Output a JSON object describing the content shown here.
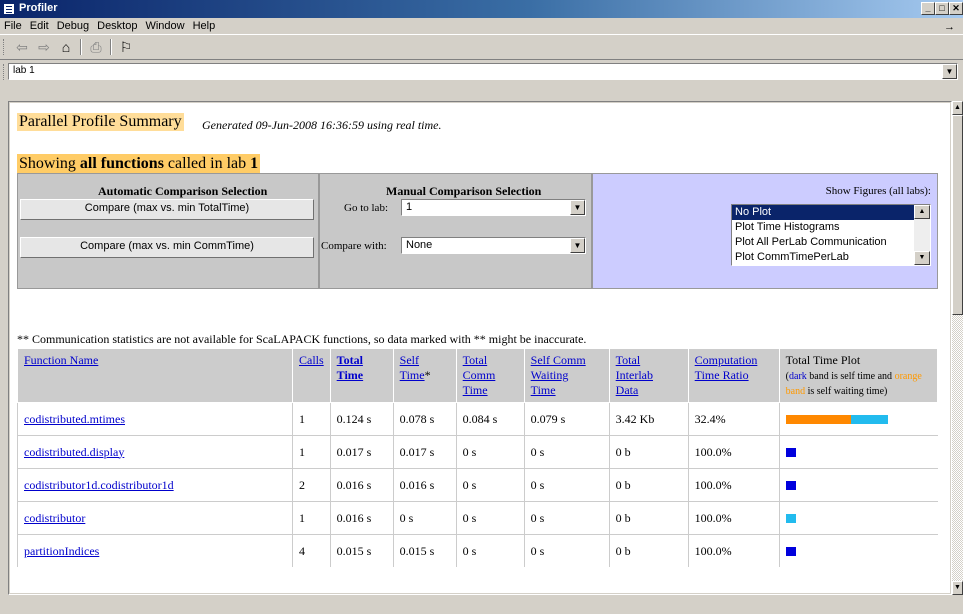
{
  "window": {
    "title": "Profiler"
  },
  "menu": [
    "File",
    "Edit",
    "Debug",
    "Desktop",
    "Window",
    "Help"
  ],
  "menu_arrow": "→",
  "toolbar": {
    "back_icon": "⇦",
    "forward_icon": "⇨",
    "home_icon": "⌂",
    "print_icon": "⎙",
    "find_icon": "⚐"
  },
  "address": {
    "value": "lab 1"
  },
  "summary": {
    "title": "Parallel Profile Summary",
    "generated": "Generated 09-Jun-2008 16:36:59 using real time.",
    "showing_prefix": "Showing ",
    "showing_bold": "all functions",
    "showing_mid": " called in lab ",
    "showing_lab": "1"
  },
  "auto": {
    "title": "Automatic Comparison Selection",
    "btn_total": "Compare (max vs. min TotalTime)",
    "btn_comm": "Compare (max vs. min CommTime)"
  },
  "manual": {
    "title": "Manual Comparison Selection",
    "goto_label": "Go to lab:",
    "goto_value": "1",
    "compare_label": "Compare with:",
    "compare_value": "None"
  },
  "figures": {
    "label": "Show Figures (all labs):",
    "options": [
      "No Plot",
      "Plot Time Histograms",
      "Plot All PerLab Communication",
      "Plot CommTimePerLab"
    ]
  },
  "note": "** Communication statistics are not available for ScaLAPACK functions, so data marked with ** might be inaccurate.",
  "table": {
    "headers": {
      "fn": "Function Name",
      "calls": "Calls",
      "total_a": "Total",
      "total_b": "Time",
      "self_a": "Self",
      "self_b": "Time",
      "self_star": "*",
      "comm_a": "Total",
      "comm_b": "Comm",
      "comm_c": "Time",
      "scw_a": "Self Comm",
      "scw_b": "Waiting",
      "scw_c": "Time",
      "ild_a": "Total",
      "ild_b": "Interlab",
      "ild_c": "Data",
      "ctr_a": "Computation",
      "ctr_b": "Time Ratio",
      "plot_title": "Total Time Plot",
      "plot_l1": "(",
      "plot_dark": "dark",
      "plot_l2": " band is self time and ",
      "plot_orange": "orange band",
      "plot_l3": " is self waiting time)"
    },
    "rows": [
      {
        "fn": "codistributed.mtimes",
        "calls": "1",
        "total": "0.124 s",
        "self": "0.078 s",
        "comm": "0.084 s",
        "scw": "0.079 s",
        "data": "3.42 Kb",
        "ratio": "32.4%"
      },
      {
        "fn": "codistributed.display",
        "calls": "1",
        "total": "0.017 s",
        "self": "0.017 s",
        "comm": "0 s",
        "scw": "0 s",
        "data": "0 b",
        "ratio": "100.0%"
      },
      {
        "fn": "codistributor1d.codistributor1d",
        "calls": "2",
        "total": "0.016 s",
        "self": "0.016 s",
        "comm": "0 s",
        "scw": "0 s",
        "data": "0 b",
        "ratio": "100.0%"
      },
      {
        "fn": "codistributor",
        "calls": "1",
        "total": "0.016 s",
        "self": "0 s",
        "comm": "0 s",
        "scw": "0 s",
        "data": "0 b",
        "ratio": "100.0%"
      },
      {
        "fn": "partitionIndices",
        "calls": "4",
        "total": "0.015 s",
        "self": "0.015 s",
        "comm": "0 s",
        "scw": "0 s",
        "data": "0 b",
        "ratio": "100.0%"
      }
    ]
  },
  "colors": {
    "dark_band": "#0000dd",
    "orange_band": "#ff8800",
    "cyan_band": "#22bbee"
  }
}
